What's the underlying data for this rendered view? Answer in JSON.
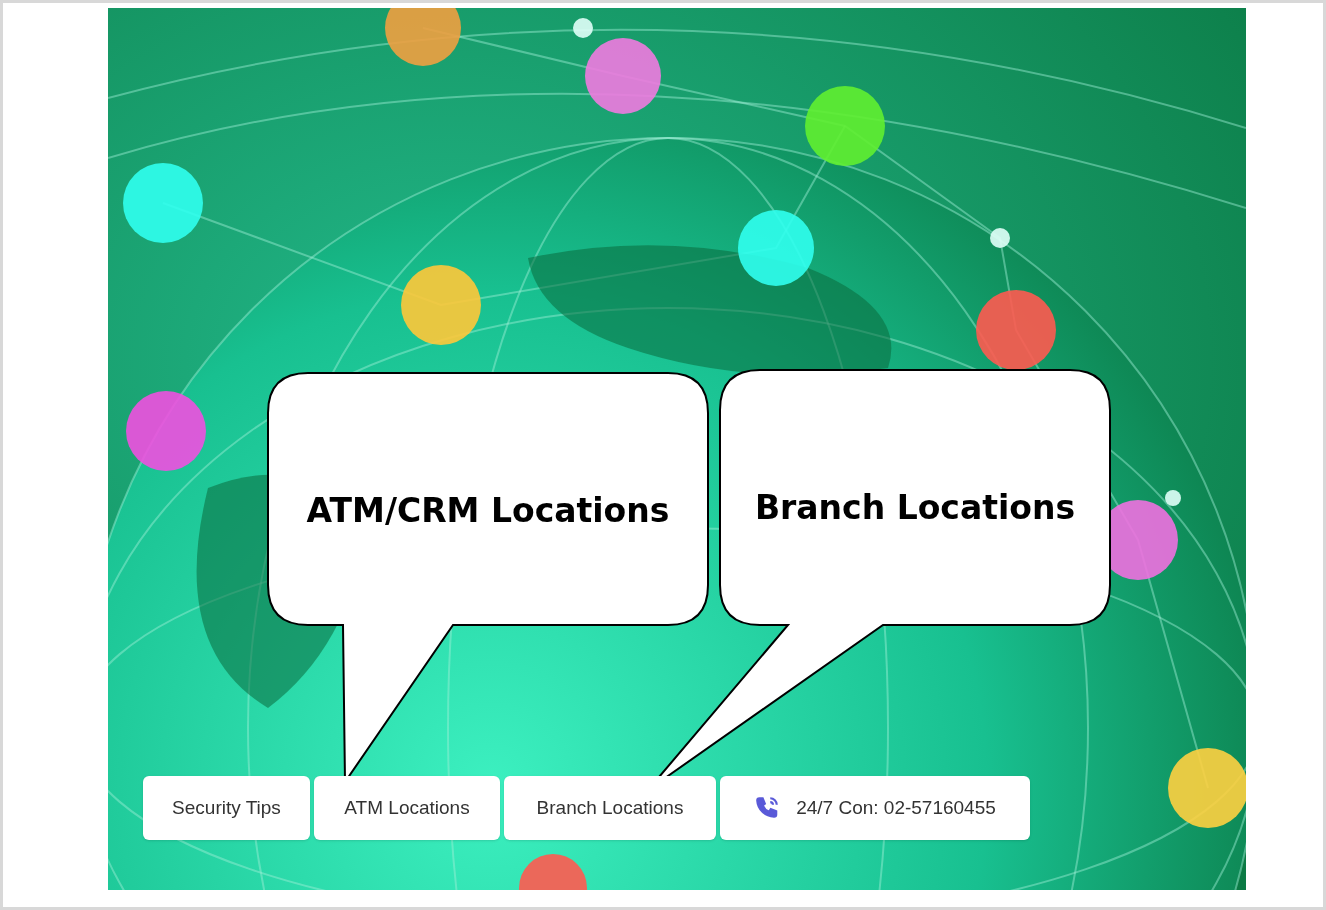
{
  "callouts": [
    {
      "text": "ATM/CRM Locations"
    },
    {
      "text": "Branch Locations"
    }
  ],
  "nav_buttons": [
    {
      "label": "Security Tips",
      "kind": "link"
    },
    {
      "label": "ATM Locations",
      "kind": "link"
    },
    {
      "label": "Branch Locations",
      "kind": "link"
    },
    {
      "label": "24/7 Con: 02-57160455",
      "kind": "phone"
    }
  ]
}
